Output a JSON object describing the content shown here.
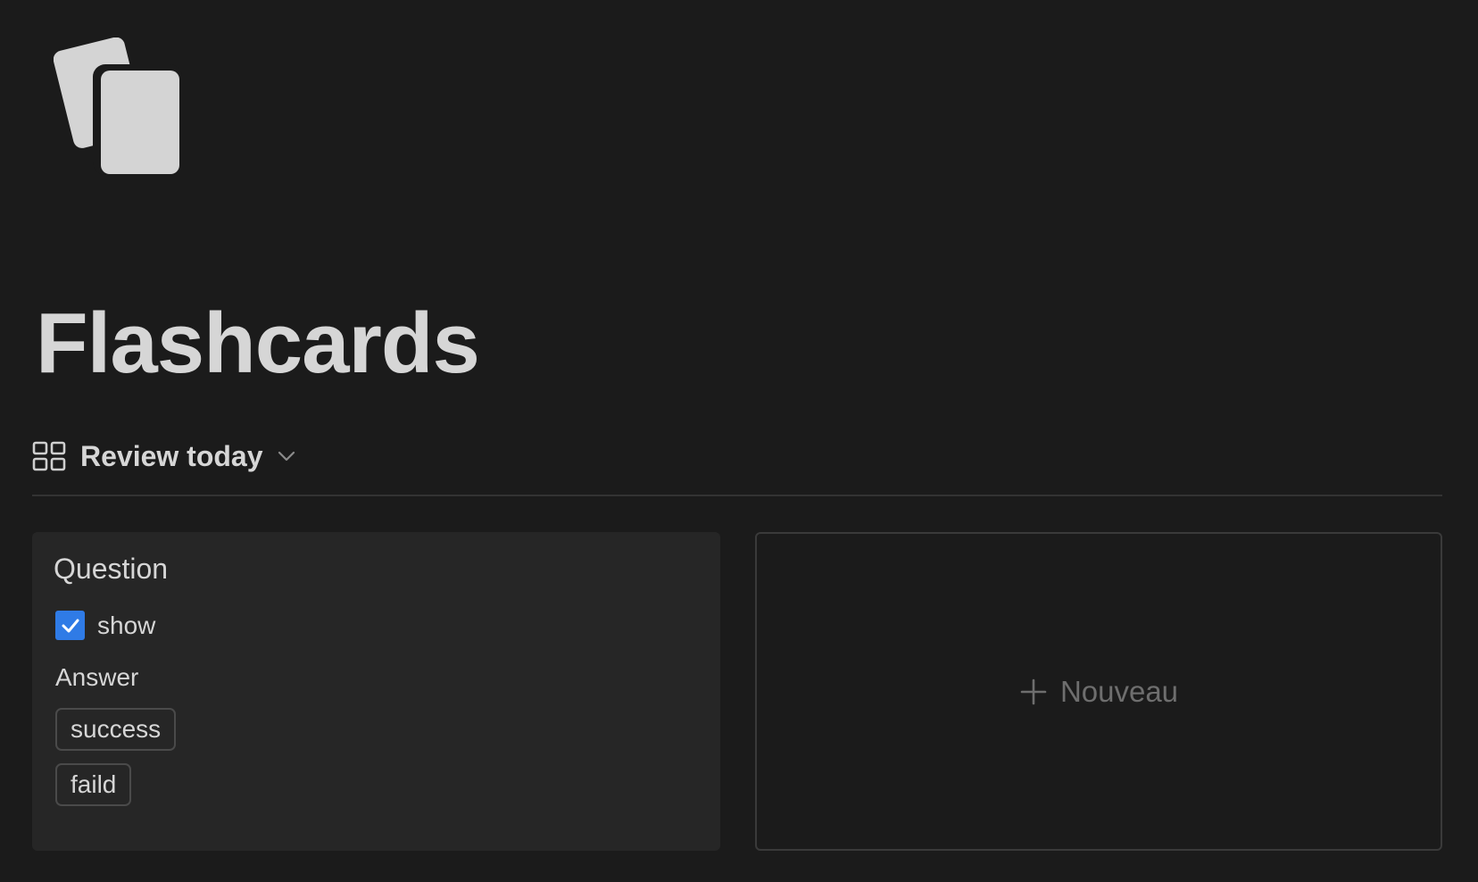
{
  "page": {
    "icon": "flashcards-icon",
    "title": "Flashcards"
  },
  "view": {
    "icon": "gallery-grid-icon",
    "label": "Review today",
    "dropdown_icon": "chevron-down-icon"
  },
  "cards": [
    {
      "title": "Question",
      "checkbox": {
        "checked": true,
        "label": "show"
      },
      "answer_label": "Answer",
      "options": [
        "success",
        "faild"
      ]
    }
  ],
  "new_card": {
    "icon": "plus-icon",
    "label": "Nouveau"
  },
  "colors": {
    "background": "#1b1b1b",
    "card_background": "#262626",
    "checkbox_accent": "#2f7be6",
    "text": "#d6d6d6",
    "muted_text": "#6e6e6e"
  }
}
